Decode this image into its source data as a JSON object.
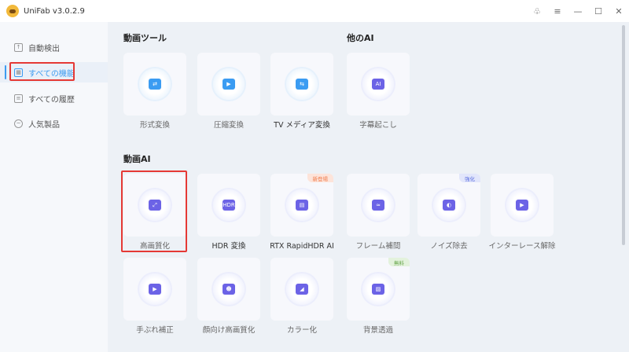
{
  "app": {
    "title": "UniFab v3.0.2.9"
  },
  "window_controls": [
    "shirt-icon",
    "menu-icon",
    "minimize-icon",
    "maximize-icon",
    "close-icon"
  ],
  "sidebar": {
    "items": [
      {
        "label": "自動検出"
      },
      {
        "label": "すべての機能",
        "active": true
      },
      {
        "label": "すべての履歴"
      },
      {
        "label": "人気製品"
      }
    ]
  },
  "sections": {
    "tools": "動画ツール",
    "other_ai": "他のAI",
    "video_ai": "動画AI"
  },
  "tools": [
    {
      "label": "形式変換"
    },
    {
      "label": "圧縮変換"
    },
    {
      "label": "TV メディア変換"
    }
  ],
  "other_ai": [
    {
      "label": "字幕起こし",
      "glyph": "AI"
    }
  ],
  "video_ai": [
    {
      "label": "高画質化"
    },
    {
      "label": "HDR 変換",
      "glyph": "HDR"
    },
    {
      "label": "RTX RapidHDR AI",
      "badge": "新登場"
    },
    {
      "label": "フレーム補間",
      "glyph": "≈"
    },
    {
      "label": "ノイズ除去",
      "badge": "強化"
    },
    {
      "label": "インターレース解除"
    },
    {
      "label": "手ぶれ補正",
      "glyph": "▶"
    },
    {
      "label": "顔向け高画質化"
    },
    {
      "label": "カラー化"
    },
    {
      "label": "背景透過",
      "badge": "無料"
    }
  ],
  "colors": {
    "accent": "#3d9cf0",
    "highlight": "#e53935",
    "badge_new": "#f07a4a",
    "badge_enhance": "#5a6ee0",
    "badge_free": "#6aa84f"
  }
}
